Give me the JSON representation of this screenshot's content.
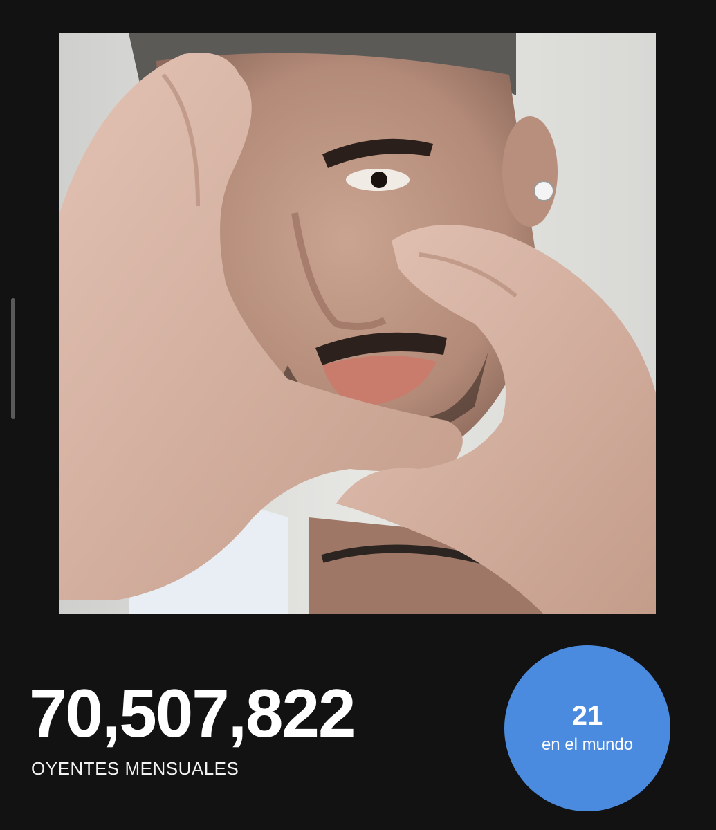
{
  "stats": {
    "monthly_listeners": "70,507,822",
    "listeners_label": "OYENTES MENSUALES"
  },
  "rank": {
    "position": "21",
    "caption": "en el mundo"
  },
  "colors": {
    "background": "#121212",
    "badge": "#4a8be0",
    "text": "#ffffff"
  }
}
